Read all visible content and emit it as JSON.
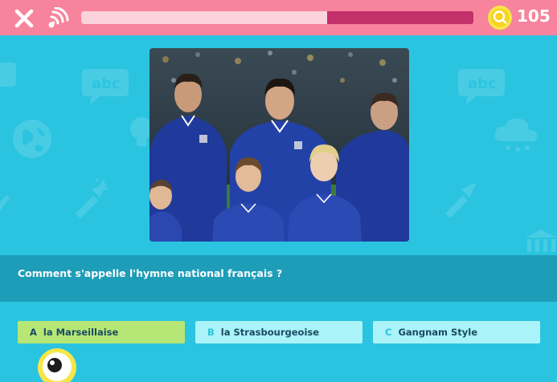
{
  "header": {
    "close_icon": "close-icon",
    "audio_icon": "audio-icon",
    "progress_fraction": 0.627,
    "coin_icon": "coin-icon",
    "coin_count": "105",
    "colors": {
      "bar": "#f7849c",
      "progress_track": "#c3306a",
      "progress_fill": "#fbd3dc"
    }
  },
  "question": {
    "image_alt": "Équipe de France de football pendant l'hymne",
    "text": "Comment s'appelle l'hymne national français ?"
  },
  "answers": [
    {
      "letter": "A",
      "label": "la Marseillaise"
    },
    {
      "letter": "B",
      "label": "la Strasbourgeoise"
    },
    {
      "letter": "C",
      "label": "Gangnam Style"
    }
  ],
  "mascot": {
    "icon": "eye-icon"
  }
}
